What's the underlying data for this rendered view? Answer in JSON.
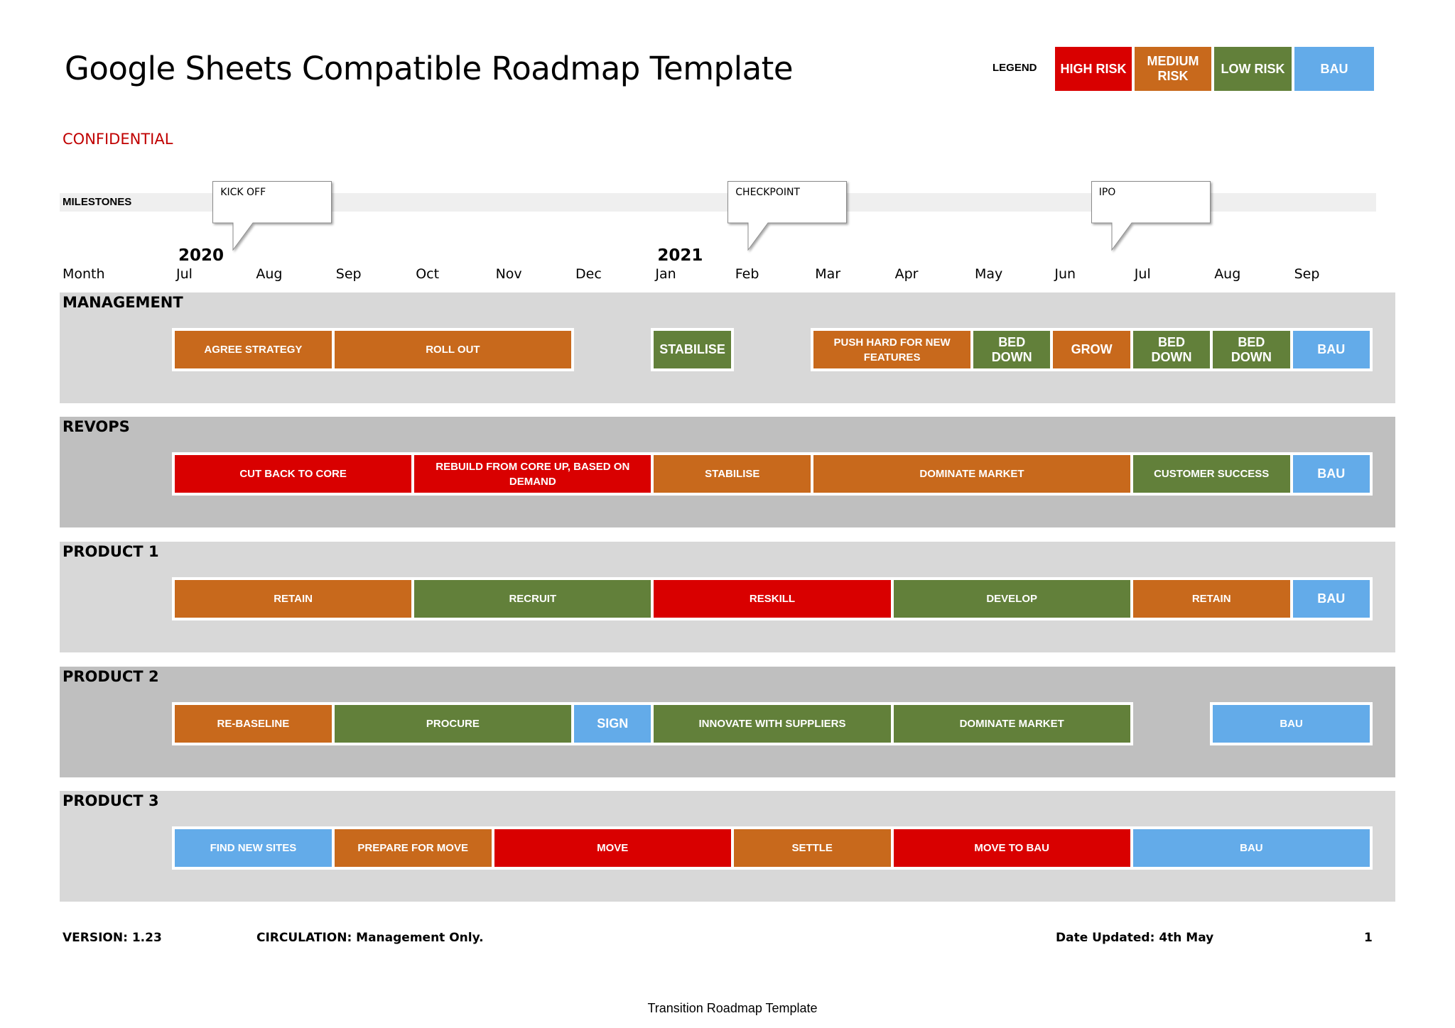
{
  "header": {
    "title": "Google Sheets Compatible Roadmap Template",
    "confidential": "CONFIDENTIAL"
  },
  "legend": {
    "label": "LEGEND",
    "items": [
      {
        "key": "high",
        "label": "HIGH RISK",
        "color": "#D90000"
      },
      {
        "key": "medium",
        "label": "MEDIUM RISK",
        "color": "#C8691C"
      },
      {
        "key": "low",
        "label": "LOW RISK",
        "color": "#62803A"
      },
      {
        "key": "bau",
        "label": "BAU",
        "color": "#63ABE9"
      }
    ]
  },
  "milestones": {
    "label": "MILESTONES",
    "items": [
      {
        "label": "KICK OFF",
        "month_index": 0.75
      },
      {
        "label": "CHECKPOINT",
        "month_index": 7.2
      },
      {
        "label": "IPO",
        "month_index": 11.75
      }
    ]
  },
  "timeline": {
    "row_label": "Month",
    "years": [
      {
        "label": "2020",
        "month_index": 0
      },
      {
        "label": "2021",
        "month_index": 6
      }
    ],
    "months": [
      "Jul",
      "Aug",
      "Sep",
      "Oct",
      "Nov",
      "Dec",
      "Jan",
      "Feb",
      "Mar",
      "Apr",
      "May",
      "Jun",
      "Jul",
      "Aug",
      "Sep"
    ]
  },
  "sections": [
    {
      "title": "MANAGEMENT",
      "tracks": [
        [
          0,
          5
        ],
        [
          6,
          7
        ],
        [
          8,
          15
        ]
      ],
      "bars": [
        {
          "label": "AGREE STRATEGY",
          "start": 0,
          "end": 2,
          "risk": "medium"
        },
        {
          "label": "ROLL OUT",
          "start": 2,
          "end": 5,
          "risk": "medium"
        },
        {
          "label": "STABILISE",
          "start": 6,
          "end": 7,
          "risk": "low",
          "style": "arial"
        },
        {
          "label": "PUSH HARD FOR NEW FEATURES",
          "start": 8,
          "end": 10,
          "risk": "medium"
        },
        {
          "label": "BED DOWN",
          "start": 10,
          "end": 11,
          "risk": "low",
          "style": "arial"
        },
        {
          "label": "GROW",
          "start": 11,
          "end": 12,
          "risk": "medium",
          "style": "arial"
        },
        {
          "label": "BED DOWN",
          "start": 12,
          "end": 13,
          "risk": "low",
          "style": "arial"
        },
        {
          "label": "BED DOWN",
          "start": 13,
          "end": 14,
          "risk": "low",
          "style": "arial"
        },
        {
          "label": "BAU",
          "start": 14,
          "end": 15,
          "risk": "bau",
          "style": "arial"
        }
      ]
    },
    {
      "title": "REVOPS",
      "tracks": [
        [
          0,
          15
        ]
      ],
      "bars": [
        {
          "label": "CUT BACK TO CORE",
          "start": 0,
          "end": 3,
          "risk": "high"
        },
        {
          "label": "REBUILD FROM CORE UP, BASED ON DEMAND",
          "start": 3,
          "end": 6,
          "risk": "high"
        },
        {
          "label": "STABILISE",
          "start": 6,
          "end": 8,
          "risk": "medium"
        },
        {
          "label": "DOMINATE MARKET",
          "start": 8,
          "end": 12,
          "risk": "medium"
        },
        {
          "label": "CUSTOMER SUCCESS",
          "start": 12,
          "end": 14,
          "risk": "low"
        },
        {
          "label": "BAU",
          "start": 14,
          "end": 15,
          "risk": "bau",
          "style": "arial"
        }
      ]
    },
    {
      "title": "PRODUCT 1",
      "tracks": [
        [
          0,
          15
        ]
      ],
      "bars": [
        {
          "label": "RETAIN",
          "start": 0,
          "end": 3,
          "risk": "medium"
        },
        {
          "label": "RECRUIT",
          "start": 3,
          "end": 6,
          "risk": "low"
        },
        {
          "label": "RESKILL",
          "start": 6,
          "end": 9,
          "risk": "high"
        },
        {
          "label": "DEVELOP",
          "start": 9,
          "end": 12,
          "risk": "low"
        },
        {
          "label": "RETAIN",
          "start": 12,
          "end": 14,
          "risk": "medium"
        },
        {
          "label": "BAU",
          "start": 14,
          "end": 15,
          "risk": "bau",
          "style": "arial"
        }
      ]
    },
    {
      "title": "PRODUCT 2",
      "tracks": [
        [
          0,
          12
        ],
        [
          13,
          15
        ]
      ],
      "bars": [
        {
          "label": "RE-BASELINE",
          "start": 0,
          "end": 2,
          "risk": "medium"
        },
        {
          "label": "PROCURE",
          "start": 2,
          "end": 5,
          "risk": "low"
        },
        {
          "label": "SIGN",
          "start": 5,
          "end": 6,
          "risk": "bau",
          "style": "arial"
        },
        {
          "label": "INNOVATE WITH SUPPLIERS",
          "start": 6,
          "end": 9,
          "risk": "low"
        },
        {
          "label": "DOMINATE MARKET",
          "start": 9,
          "end": 12,
          "risk": "low"
        },
        {
          "label": "BAU",
          "start": 13,
          "end": 15,
          "risk": "bau"
        }
      ]
    },
    {
      "title": "PRODUCT 3",
      "tracks": [
        [
          0,
          15
        ]
      ],
      "bars": [
        {
          "label": "FIND NEW SITES",
          "start": 0,
          "end": 2,
          "risk": "bau"
        },
        {
          "label": "PREPARE FOR MOVE",
          "start": 2,
          "end": 4,
          "risk": "medium"
        },
        {
          "label": "MOVE",
          "start": 4,
          "end": 7,
          "risk": "high"
        },
        {
          "label": "SETTLE",
          "start": 7,
          "end": 9,
          "risk": "medium"
        },
        {
          "label": "MOVE TO BAU",
          "start": 9,
          "end": 12,
          "risk": "high"
        },
        {
          "label": "BAU",
          "start": 12,
          "end": 15,
          "risk": "bau"
        }
      ]
    }
  ],
  "footer": {
    "version": "VERSION: 1.23",
    "circulation": "CIRCULATION: Management Only.",
    "date_updated": "Date Updated: 4th May",
    "page_number": "1",
    "caption": "Transition Roadmap Template"
  },
  "colors": {
    "section_light": "#D8D8D8",
    "section_dark": "#BFBFBF"
  }
}
